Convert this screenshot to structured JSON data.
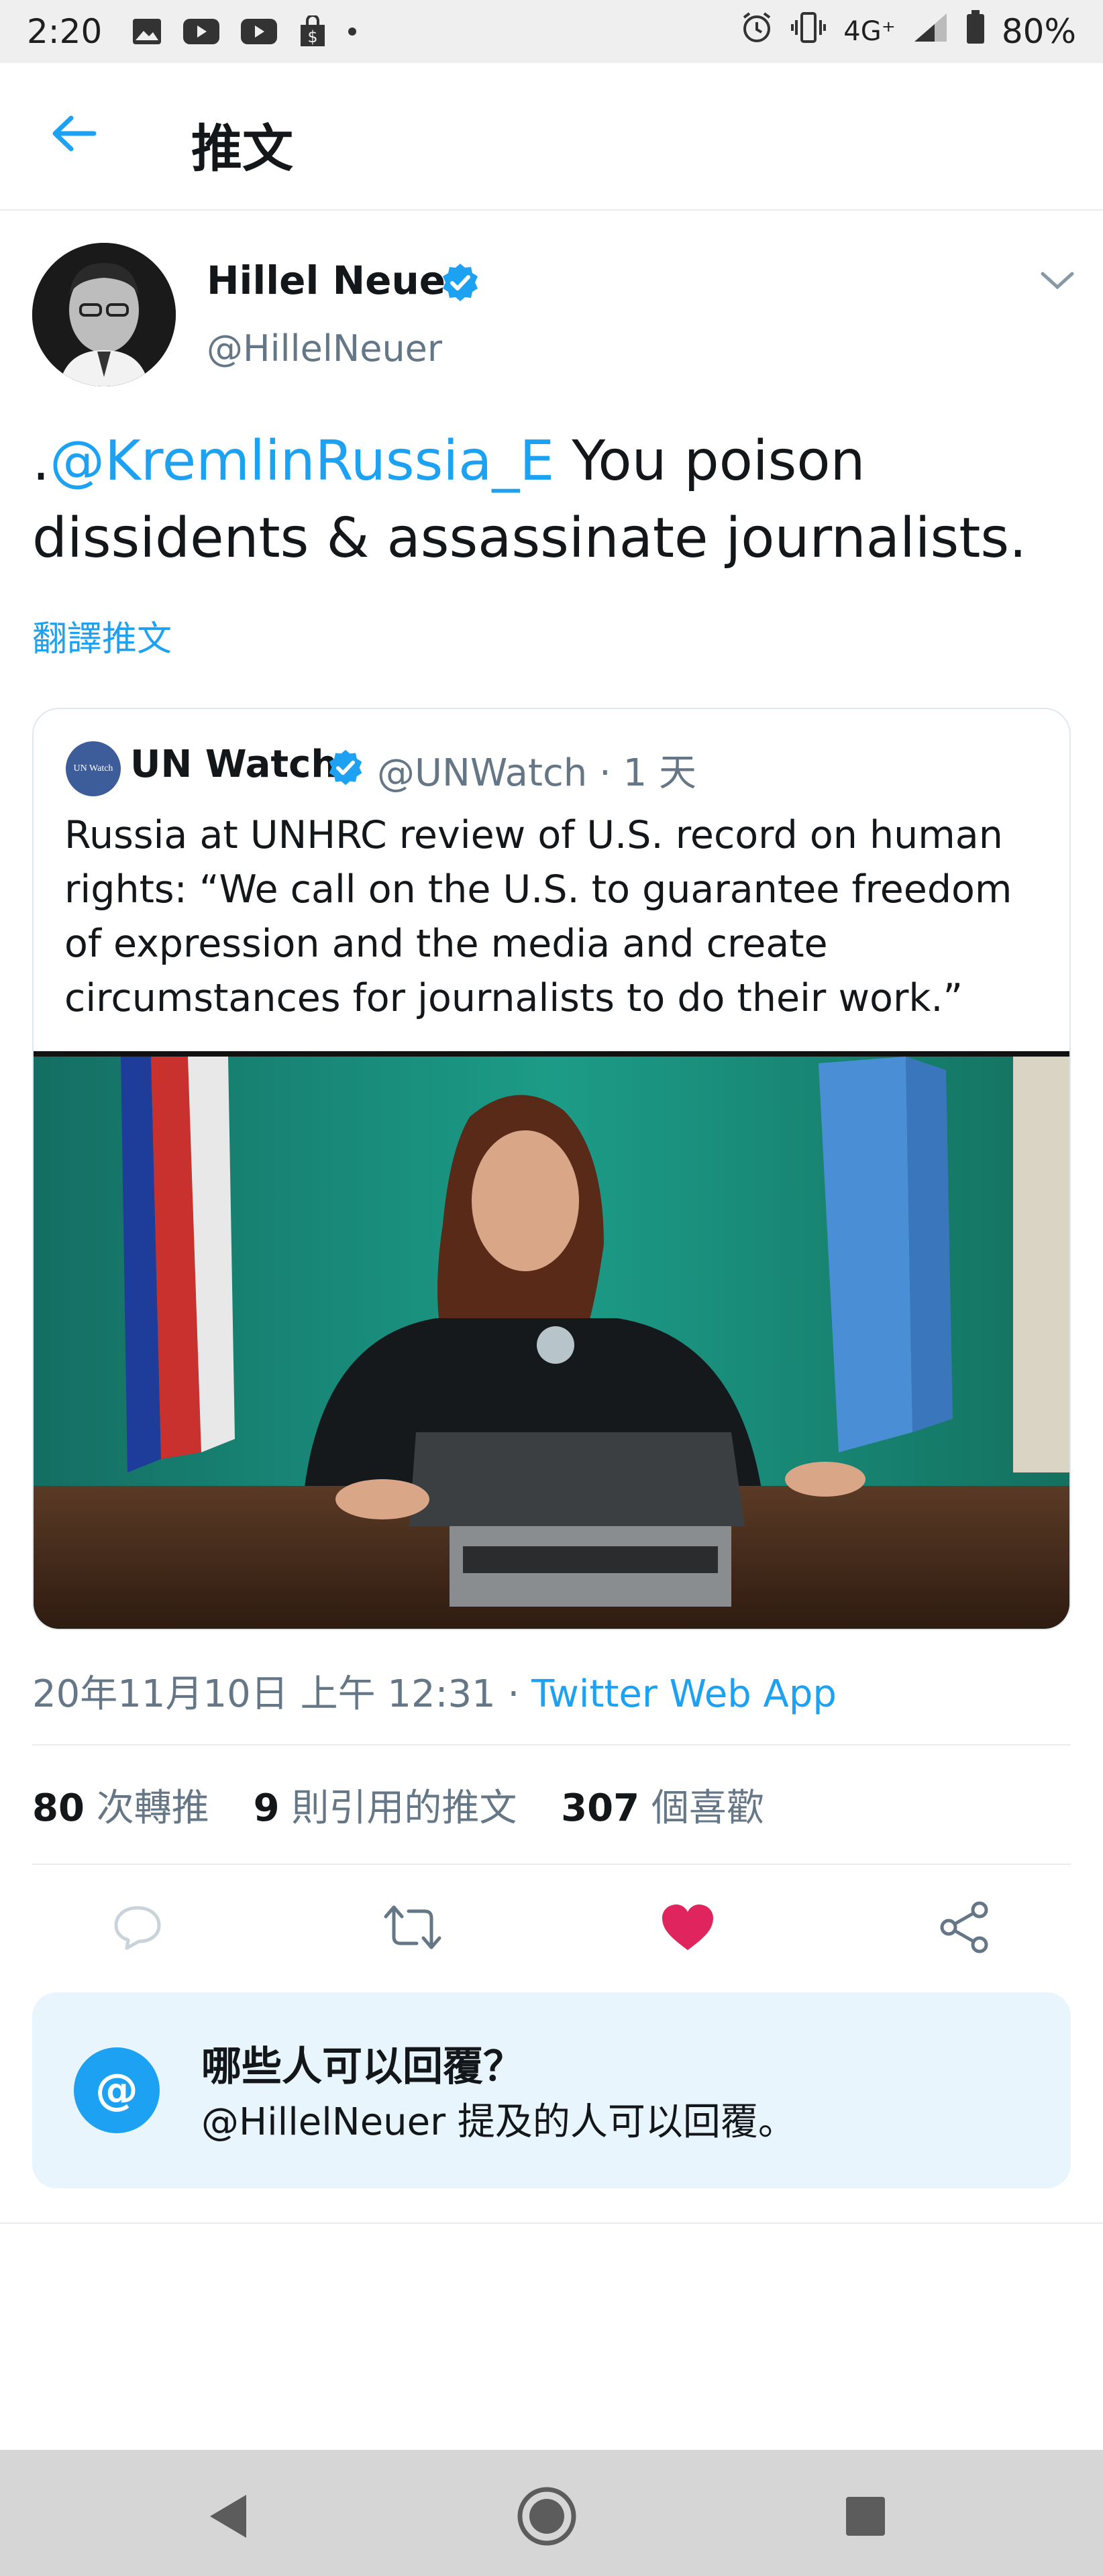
{
  "status_bar": {
    "time": "2:20",
    "network": "4G⁺",
    "battery": "80%",
    "icons": [
      "gallery-icon",
      "youtube-icon",
      "youtube-icon",
      "shopping-bag-icon",
      "dot-icon",
      "alarm-icon",
      "vibrate-icon",
      "signal-icon",
      "battery-icon"
    ]
  },
  "header": {
    "title": "推文",
    "back_icon": "arrow-left-icon"
  },
  "tweet": {
    "author_name": "Hillel Neuer",
    "author_handle": "@HillelNeuer",
    "text_prefix": ".",
    "text_mention": "@KremlinRussia_E",
    "text_body": " You poison dissidents & assassinate journalists.",
    "translate_label": "翻譯推文",
    "timestamp": "20年11月10日 上午 12:31 · ",
    "source": "Twitter Web App"
  },
  "quoted": {
    "avatar_text": "UN Watch",
    "name": "UN Watch",
    "handle_time": "@UNWatch · 1 天",
    "text": "Russia at UNHRC review of U.S. record on human rights: “We call on the U.S. to guarantee freedom of expression and the media and create circumstances for journalists to do their work.”"
  },
  "stats": {
    "retweets_count": "80",
    "retweets_label": " 次轉推",
    "quotes_count": "9",
    "quotes_label": " 則引用的推文",
    "likes_count": "307",
    "likes_label": " 個喜歡"
  },
  "actions": {
    "reply_icon": "reply-icon",
    "retweet_icon": "retweet-icon",
    "like_icon": "heart-icon",
    "share_icon": "share-icon",
    "like_color": "#e0245e"
  },
  "who_can_reply": {
    "icon_text": "@",
    "title": "哪些人可以回覆？",
    "description": "@HillelNeuer 提及的人可以回覆。"
  },
  "colors": {
    "accent": "#1da1f2",
    "secondary_text": "#657786"
  }
}
